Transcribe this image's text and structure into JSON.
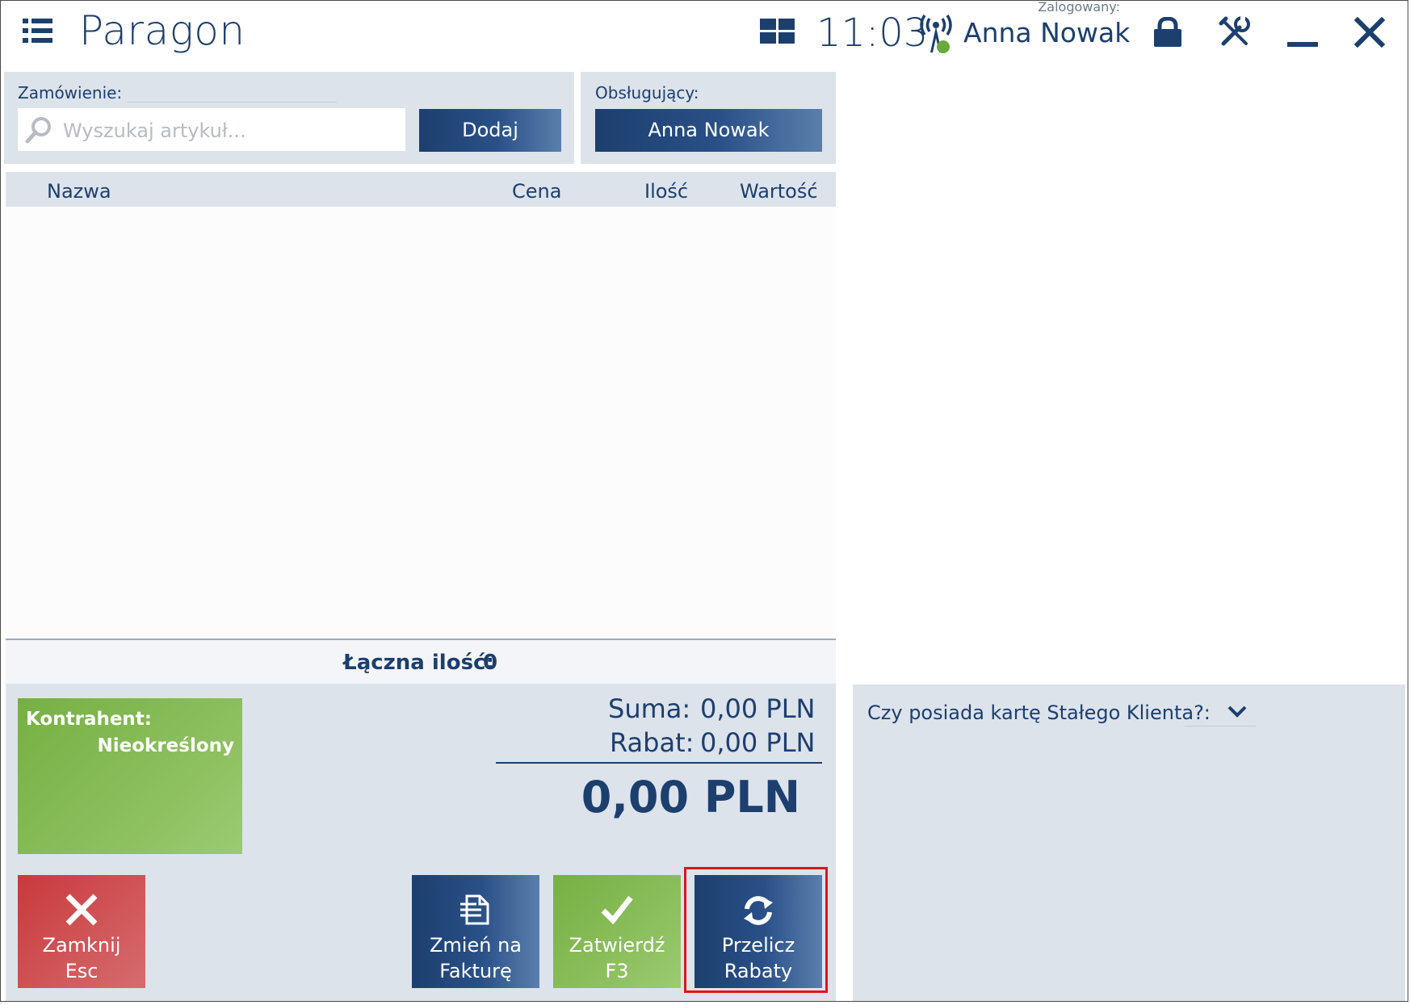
{
  "header": {
    "title": "Paragon",
    "clock": "11:03",
    "logged_label": "Zalogowany:",
    "user_name": "Anna Nowak",
    "icons": [
      "menu-icon",
      "tiles-icon",
      "signal-icon",
      "lock-icon",
      "tools-icon",
      "minimize-icon",
      "close-icon"
    ]
  },
  "order": {
    "label": "Zamówienie:",
    "search_placeholder": "Wyszukaj artykuł...",
    "add_button": "Dodaj"
  },
  "waiter": {
    "label": "Obsługujący:",
    "button": "Anna Nowak"
  },
  "table": {
    "columns": [
      "Nazwa",
      "Cena",
      "Ilość",
      "Wartość"
    ],
    "rows": []
  },
  "quantity": {
    "label": "Łączna ilość:",
    "value": "0"
  },
  "contractor": {
    "label": "Kontrahent:",
    "value": "Nieokreślony"
  },
  "totals": {
    "sum_label": "Suma:",
    "sum_value": "0,00 PLN",
    "discount_label": "Rabat:",
    "discount_value": "0,00 PLN",
    "grand_total": "0,00 PLN"
  },
  "actions": {
    "close": {
      "line1": "Zamknij",
      "line2": "Esc"
    },
    "invoice": {
      "line1": "Zmień na",
      "line2": "Fakturę"
    },
    "confirm": {
      "line1": "Zatwierdź",
      "line2": "F3"
    },
    "recalc": {
      "line1": "Przelicz",
      "line2": "Rabaty"
    }
  },
  "loyalty": {
    "label": "Czy posiada kartę Stałego Klienta?:",
    "value": ""
  },
  "colors": {
    "navy": "#1c3f6e",
    "panel": "#dde3eb",
    "green": "#8fc161",
    "red": "#d05558",
    "highlight": "#e0141c"
  }
}
